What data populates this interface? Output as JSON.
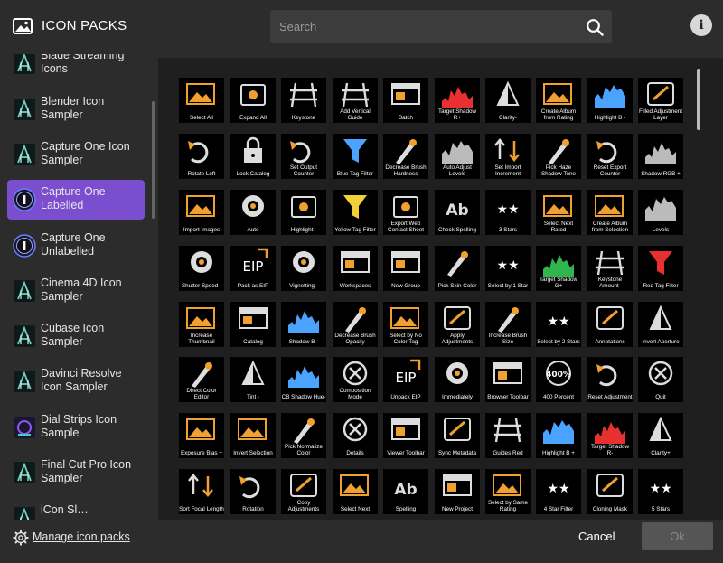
{
  "header": {
    "title": "ICON PACKS",
    "search_placeholder": "Search",
    "info_label": "i"
  },
  "sidebar": {
    "items": [
      {
        "label": "Blade Streaming Icons",
        "icon": "blade-pack-icon",
        "active": false
      },
      {
        "label": "Blender Icon Sampler",
        "icon": "blender-pack-icon",
        "active": false
      },
      {
        "label": "Capture One Icon Sampler",
        "icon": "capture-one-pack-icon",
        "active": false
      },
      {
        "label": "Capture One Labelled",
        "icon": "capture-one-logo-icon",
        "active": true
      },
      {
        "label": "Capture One Unlabelled",
        "icon": "capture-one-logo-icon",
        "active": false
      },
      {
        "label": "Cinema 4D Icon Sampler",
        "icon": "cinema4d-pack-icon",
        "active": false
      },
      {
        "label": "Cubase Icon Sampler",
        "icon": "cubase-pack-icon",
        "active": false
      },
      {
        "label": "Davinci Resolve Icon Sampler",
        "icon": "davinci-pack-icon",
        "active": false
      },
      {
        "label": "Dial Strips Icon Sample",
        "icon": "dial-strips-pack-icon",
        "active": false
      },
      {
        "label": "Final Cut Pro Icon Sampler",
        "icon": "final-cut-pack-icon",
        "active": false
      },
      {
        "label": "iCon Sl…",
        "icon": "icon-pack-icon",
        "active": false
      }
    ]
  },
  "icons": [
    [
      "Select All",
      "Expand All",
      "Keystone",
      "Add Vertical Guide",
      "Batch",
      "Target Shadow R+",
      "Clarity-",
      "Create Album from Rating",
      "Highlight B -",
      "Filled Adjustment Layer"
    ],
    [
      "Rotate Left",
      "Lock Catalog",
      "Set Output Counter",
      "Blue Tag Filter",
      "Decrease Brush Hardness",
      "Auto Adjust Levels",
      "Set Import Increment",
      "Pick Haze Shadow Tone",
      "Reset Export Counter",
      "Shadow RGB +"
    ],
    [
      "Import Images",
      "Auto",
      "Highlight -",
      "Yellow Tag Filter",
      "Export Web Contact Sheet",
      "Check Spelling",
      "3 Stars",
      "Select Next Rated",
      "Create Album from Selection",
      "Levels"
    ],
    [
      "Shutter Speed -",
      "Pack as EIP",
      "Vignetting -",
      "Workspaces",
      "New Group",
      "Pick Skin Color",
      "Select by 1 Star",
      "Target Shadow G+",
      "Keystone Amount-",
      "Red Tag Filter"
    ],
    [
      "Increase Thumbnail",
      "Catalog",
      "Shadow B -",
      "Decrease Brush Opacity",
      "Select by No Color Tag",
      "Apply Adjustments",
      "Increase Brush Size",
      "Select by 2 Stars",
      "Annotations",
      "Invert Aperture"
    ],
    [
      "Direct Color Editor",
      "Tint -",
      "CB Shadow Hue-",
      "Composition Mode",
      "Unpack EIP",
      "Immediately",
      "Browser Toolbar",
      "400 Percent",
      "Reset Adjustment",
      "Quit"
    ],
    [
      "Exposure Bias +",
      "Invert Selection",
      "Pick Normalize Color",
      "Details",
      "Viewer Toolbar",
      "Sync Metadata",
      "Guides Red",
      "Highlight B +",
      "Target Shadow R-",
      "Clarity+"
    ],
    [
      "Sort Focal Length",
      "Rotation",
      "Copy Adjustments",
      "Select Next",
      "Spelling",
      "New Project",
      "Select by Same Rating",
      "4 Star Filter",
      "Cloning Mask",
      "5 Stars"
    ]
  ],
  "footer": {
    "manage_label": "Manage icon packs",
    "cancel_label": "Cancel",
    "ok_label": "Ok"
  },
  "colors": {
    "accent": "#7a4ecf",
    "orange": "#f0a030",
    "tile_bg": "#000000",
    "grid_bg": "#1f1f1f",
    "panel_bg": "#2c2c2c"
  }
}
